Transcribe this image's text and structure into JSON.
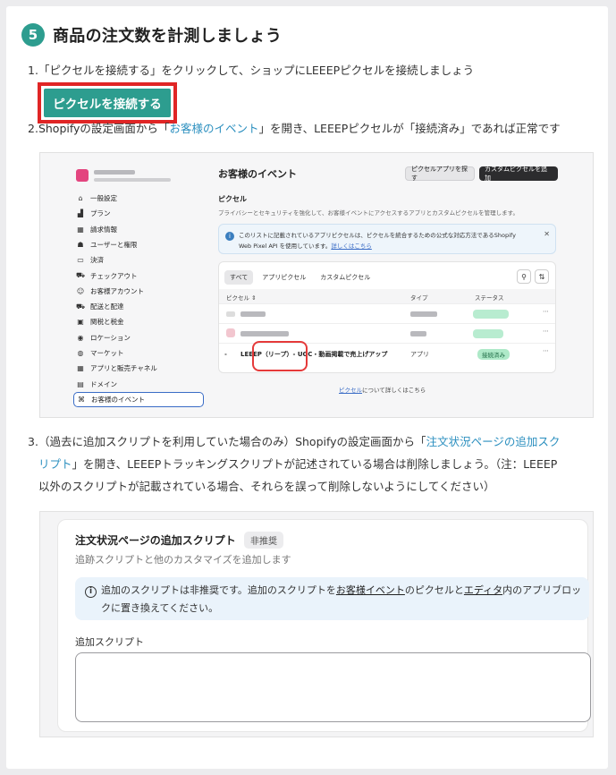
{
  "step": {
    "number": "5",
    "title": "商品の注文数を計測しましょう"
  },
  "item1": {
    "marker": "1.",
    "text": "「ピクセルを接続する」をクリックして、ショップにLEEEPピクセルを接続しましょう",
    "button_label": "ピクセルを接続する"
  },
  "item2": {
    "marker": "2.",
    "pre": "Shopifyの設定画面から「",
    "link": "お客様のイベント",
    "post": "」を開き、LEEEPピクセルが「接続済み」であれば正常です"
  },
  "shopify_events": {
    "nav": [
      {
        "icon": "⌂",
        "label": "一般設定"
      },
      {
        "icon": "▟",
        "label": "プラン"
      },
      {
        "icon": "▦",
        "label": "請求情報"
      },
      {
        "icon": "☗",
        "label": "ユーザーと権限"
      },
      {
        "icon": "▭",
        "label": "決済"
      },
      {
        "icon": "⛟",
        "label": "チェックアウト"
      },
      {
        "icon": "☺",
        "label": "お客様アカウント"
      },
      {
        "icon": "⛟",
        "label": "配送と配達"
      },
      {
        "icon": "▣",
        "label": "関税と税金"
      },
      {
        "icon": "◉",
        "label": "ロケーション"
      },
      {
        "icon": "◍",
        "label": "マーケット"
      },
      {
        "icon": "▦",
        "label": "アプリと販売チャネル"
      },
      {
        "icon": "▤",
        "label": "ドメイン"
      },
      {
        "icon": "⌘",
        "label": "お客様のイベント"
      }
    ],
    "title": "お客様のイベント",
    "explore_button": "ピクセルアプリを探す",
    "custom_button": "カスタムピクセルを追加",
    "section": "ピクセル",
    "section_desc": "プライバシーとセキュリティを強化して、お客様イベントにアクセスするアプリとカスタムピクセルを管理します。",
    "info_line1": "このリストに記載されているアプリピクセルは、ピクセルを統合するための公式な対応方法であるShopify",
    "info_line2_pre": "Web Pixel API を使用しています。",
    "info_link": "詳しくはこちら",
    "tabs": [
      "すべて",
      "アプリピクセル",
      "カスタムピクセル"
    ],
    "columns": [
      "ピクセル ⇕",
      "タイプ",
      "ステータス"
    ],
    "leeep_row": {
      "name": "LEEEP（リープ）- UGC・動画掲載で売上げアップ",
      "type": "アプリ",
      "status": "接続済み",
      "more": "⋯"
    },
    "footer_link": "ピクセル",
    "footer_text": "について詳しくはこちら"
  },
  "item3": {
    "marker": "3.",
    "pre": "（過去に追加スクリプトを利用していた場合のみ）Shopifyの設定画面から「",
    "link_a": "注文状況ページの追加スク",
    "link_b": "リプト",
    "post_a": "」を開き、LEEEPトラッキングスクリプトが記述されている場合は削除しましょう。（注：LEEEP",
    "post_b": "以外のスクリプトが記載されている場合、それらを誤って削除しないようにしてください）"
  },
  "additional_scripts": {
    "title": "注文状況ページの追加スクリプト",
    "badge": "非推奨",
    "subtitle": "追跡スクリプトと他のカスタマイズを追加します",
    "info_pre": "追加のスクリプトは非推奨です。追加のスクリプトを",
    "info_link1": "お客様イベント",
    "info_mid": "のピクセルと",
    "info_link2": "エディタ",
    "info_post": "内のアプリブロックに置き換えてください。",
    "field_label": "追加スクリプト",
    "field_value": ""
  }
}
